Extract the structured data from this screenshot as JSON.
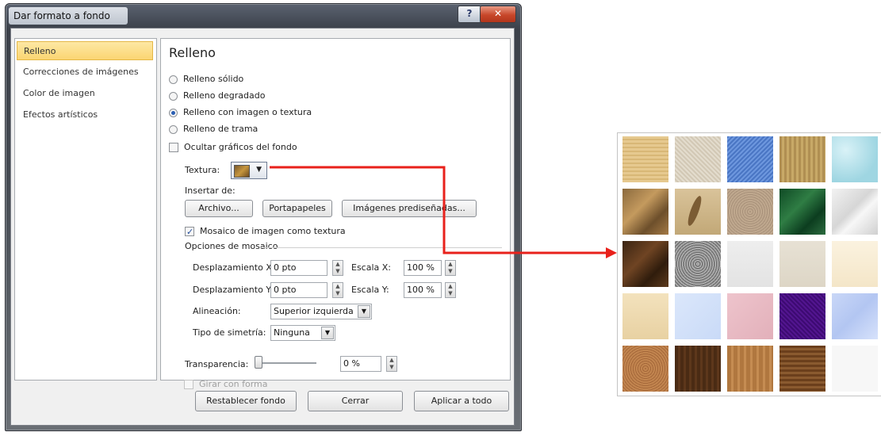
{
  "dialog": {
    "title": "Dar formato a fondo",
    "help_label": "?",
    "close_label": "✕"
  },
  "nav": {
    "items": [
      {
        "label": "Relleno",
        "selected": true
      },
      {
        "label": "Correcciones de imágenes",
        "selected": false
      },
      {
        "label": "Color de imagen",
        "selected": false
      },
      {
        "label": "Efectos artísticos",
        "selected": false
      }
    ]
  },
  "panel": {
    "title": "Relleno",
    "fill_options": [
      {
        "label": "Relleno sólido",
        "checked": false
      },
      {
        "label": "Relleno degradado",
        "checked": false
      },
      {
        "label": "Relleno con imagen o textura",
        "checked": true
      },
      {
        "label": "Relleno de trama",
        "checked": false
      }
    ],
    "hide_graphics": {
      "label": "Ocultar gráficos del fondo",
      "checked": false
    },
    "texture_label": "Textura:",
    "insert_from_label": "Insertar de:",
    "insert_buttons": [
      "Archivo...",
      "Portapapeles",
      "Imágenes prediseñadas..."
    ],
    "tile_checkbox": {
      "label": "Mosaico de imagen como textura",
      "checked": true
    },
    "tile_options_label": "Opciones de mosaico",
    "offset_x": {
      "label": "Desplazamiento X:",
      "value": "0 pto"
    },
    "offset_y": {
      "label": "Desplazamiento Y:",
      "value": "0 pto"
    },
    "scale_x": {
      "label": "Escala X:",
      "value": "100 %"
    },
    "scale_y": {
      "label": "Escala Y:",
      "value": "100 %"
    },
    "alignment": {
      "label": "Alineación:",
      "value": "Superior izquierda"
    },
    "mirror_type": {
      "label": "Tipo de simetría:",
      "value": "Ninguna"
    },
    "transparency": {
      "label": "Transparencia:",
      "value": "0 %",
      "level": 0
    },
    "rotate_with_shape": {
      "label": "Girar con forma",
      "checked": false,
      "disabled": true
    }
  },
  "footer": {
    "reset": "Restablecer fondo",
    "close": "Cerrar",
    "apply_all": "Aplicar a todo"
  },
  "colors": {
    "selection_fill": "#fbd572",
    "arrow": "#e8211b",
    "close_button": "#c7462a"
  },
  "texture_gallery": {
    "rows": [
      [
        "papyrus",
        "canvas",
        "denim",
        "woven-mat",
        "water-droplets"
      ],
      [
        "paper-bag",
        "fish-fossil",
        "sand",
        "green-marble",
        "white-marble"
      ],
      [
        "brown-marble",
        "granite",
        "newsprint",
        "recycled-paper",
        "parchment"
      ],
      [
        "stationery",
        "blue-tissue-paper",
        "pink-tissue-paper",
        "purple-mesh",
        "bouquet"
      ],
      [
        "cork",
        "walnut",
        "oak",
        "medium-wood",
        "empty"
      ]
    ]
  }
}
